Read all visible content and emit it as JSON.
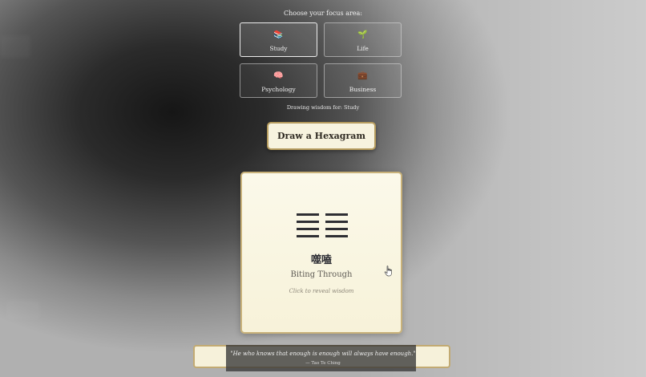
{
  "focus": {
    "label": "Choose your focus area:",
    "options": [
      {
        "emoji": "📚",
        "label": "Study",
        "selected": true
      },
      {
        "emoji": "🌱",
        "label": "Life",
        "selected": false
      },
      {
        "emoji": "🧠",
        "label": "Psychology",
        "selected": false
      },
      {
        "emoji": "💼",
        "label": "Business",
        "selected": false
      }
    ],
    "status": "Drawing wisdom for: Study"
  },
  "draw_button": {
    "label": "Draw a Hexagram"
  },
  "card": {
    "lines": [
      "broken",
      "broken",
      "broken",
      "broken",
      "solid",
      "solid"
    ],
    "hanzi": "噬嗑",
    "name": "Biting Through",
    "reveal_hint": "Click to reveal wisdom"
  },
  "quote": {
    "text": "\"He who knows that enough is enough will always have enough.\"",
    "source": "— Tao Te Ching"
  },
  "colors": {
    "card_border": "#c9b27a",
    "button_border": "#b69c5e",
    "hex_line": "#2e2e33"
  }
}
